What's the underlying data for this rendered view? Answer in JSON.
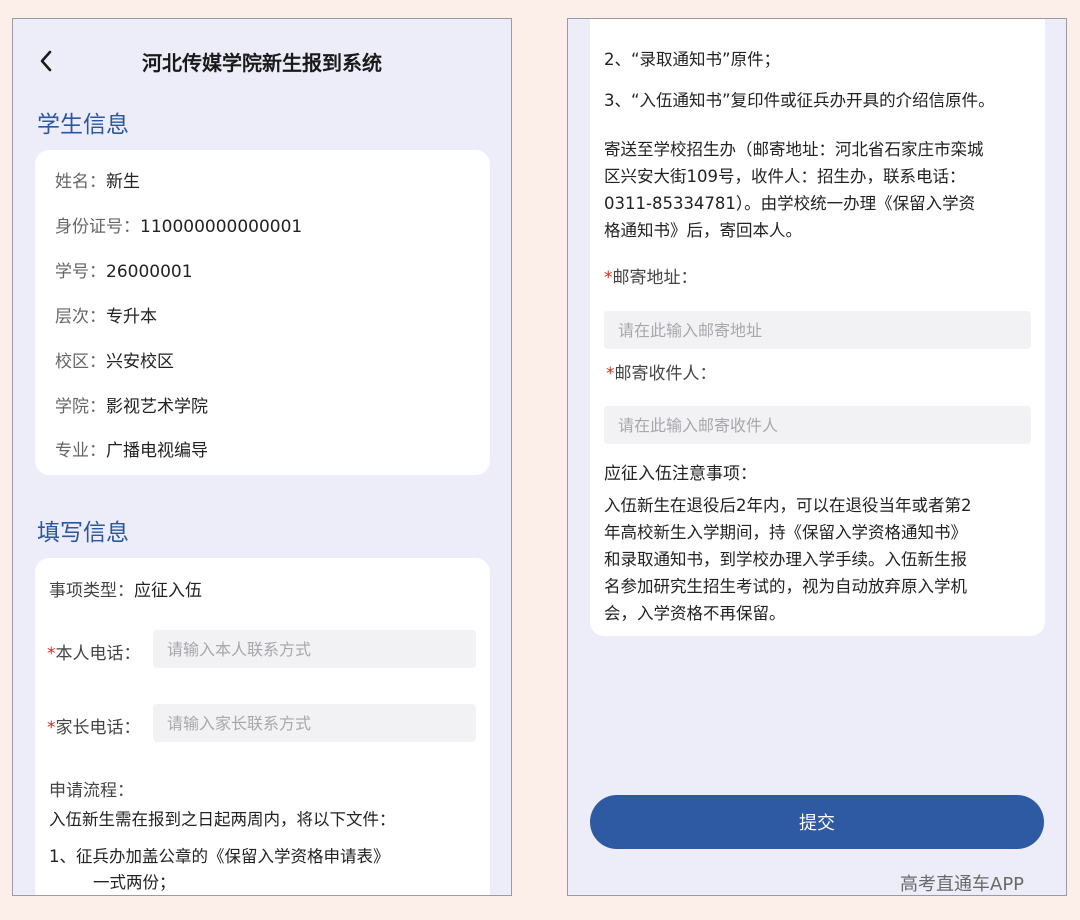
{
  "header": {
    "title": "河北传媒学院新生报到系统"
  },
  "student_info": {
    "title": "学生信息",
    "fields": [
      {
        "label": "姓名：",
        "value": "新生"
      },
      {
        "label": "身份证号：",
        "value": "110000000000001"
      },
      {
        "label": "学号：",
        "value": "26000001"
      },
      {
        "label": "层次：",
        "value": "专升本"
      },
      {
        "label": "校区：",
        "value": "兴安校区"
      },
      {
        "label": "学院：",
        "value": "影视艺术学院"
      },
      {
        "label": "专业：",
        "value": "广播电视编导"
      }
    ]
  },
  "fill_info": {
    "title": "填写信息",
    "type_label": "事项类型：",
    "type_value": "应征入伍",
    "phone_label": "本人电话：",
    "phone_placeholder": "请输入本人联系方式",
    "parent_phone_label": "家长电话：",
    "parent_phone_placeholder": "请输入家长联系方式",
    "process_title": "申请流程：",
    "process_intro": "入伍新生需在报到之日起两周内，将以下文件：",
    "process_item1_line1": "1、征兵办加盖公章的《保留入学资格申请表》",
    "process_item1_line2": "一式两份；"
  },
  "right_panel": {
    "item2": "2、“录取通知书”原件；",
    "item3": "3、“入伍通知书”复印件或征兵办开具的介绍信原件。",
    "mail_lines": [
      "寄送至学校招生办（邮寄地址：河北省石家庄市栾城",
      "区兴安大街109号，收件人：招生办，联系电话：",
      "0311-85334781）。由学校统一办理《保留入学资",
      "格通知书》后，寄回本人。"
    ],
    "address_label": "邮寄地址：",
    "address_placeholder": "请在此输入邮寄地址",
    "recipient_label": "邮寄收件人：",
    "recipient_placeholder": "请在此输入邮寄收件人",
    "notes_title": "应征入伍注意事项：",
    "notes_lines": [
      "入伍新生在退役后2年内，可以在退役当年或者第2",
      "年高校新生入学期间，持《保留入学资格通知书》",
      "和录取通知书，到学校办理入学手续。入伍新生报",
      "名参加研究生招生考试的，视为自动放弃原入学机",
      "会，入学资格不再保留。"
    ],
    "submit_label": "提交"
  },
  "watermark": "高考直通车APP",
  "colors": {
    "accent": "#2b57a0",
    "button": "#2d5aa3",
    "required": "#d9281e",
    "page_bg": "#fcefea",
    "phone_bg": "#ecedf8"
  },
  "icons": {
    "back": "chevron-left-icon"
  }
}
